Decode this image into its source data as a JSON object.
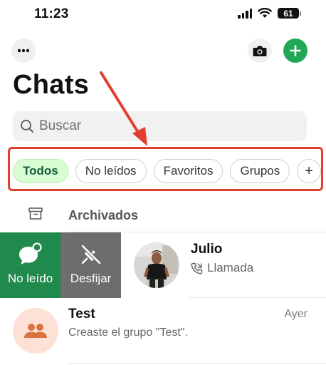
{
  "status_bar": {
    "time": "11:23",
    "battery": "61"
  },
  "header": {
    "title": "Chats"
  },
  "search": {
    "placeholder": "Buscar"
  },
  "filters": [
    {
      "label": "Todos",
      "active": true
    },
    {
      "label": "No leídos",
      "active": false
    },
    {
      "label": "Favoritos",
      "active": false
    },
    {
      "label": "Grupos",
      "active": false
    }
  ],
  "filter_more_icon": "+",
  "archived": {
    "label": "Archivados"
  },
  "swipe_actions": {
    "unread_label": "No leído",
    "unpin_label": "Desfijar"
  },
  "chats": [
    {
      "name": "Julio",
      "preview": "Llamada",
      "time": ""
    },
    {
      "name": "Test",
      "preview": "Creaste el grupo \"Test\".",
      "time": "Ayer"
    }
  ],
  "colors": {
    "accent_green": "#1fa855",
    "chip_active_bg": "#d9fdd3",
    "annotation_red": "#e2402e",
    "unread_action_bg": "#1f8a4c",
    "unpin_action_bg": "#6d6d6d"
  },
  "icons": [
    "more-icon",
    "camera-icon",
    "plus-icon",
    "search-icon",
    "archive-icon",
    "unread-chat-icon",
    "unpin-icon",
    "phone-icon",
    "group-icon"
  ]
}
